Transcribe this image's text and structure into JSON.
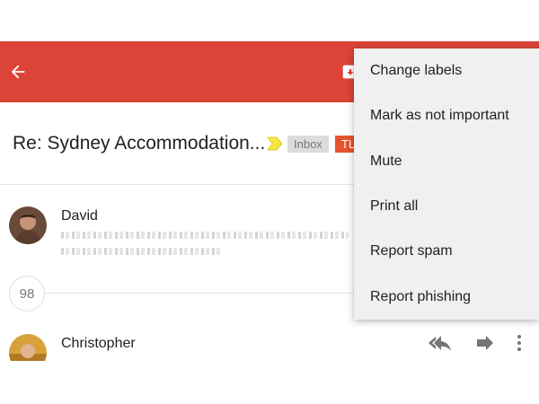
{
  "colors": {
    "appbar": "#db4437",
    "label_inbox_bg": "#dcdcdc",
    "label_tl_bg": "#e5532f",
    "important_marker": "#f5e642"
  },
  "appbar": {
    "back_icon": "arrow-back-icon",
    "archive_icon": "archive-icon"
  },
  "thread": {
    "subject": "Re: Sydney Accommodation...",
    "labels": [
      "Inbox",
      "TL"
    ]
  },
  "messages": [
    {
      "sender": "David"
    },
    {
      "sender": "Christopher"
    }
  ],
  "collapsed": {
    "count": "98"
  },
  "message_actions": {
    "reply_all_icon": "reply-all-icon",
    "forward_icon": "forward-icon",
    "more_icon": "more-vert-icon"
  },
  "overflow_menu": {
    "items": [
      "Change labels",
      "Mark as not important",
      "Mute",
      "Print all",
      "Report spam",
      "Report phishing"
    ]
  }
}
